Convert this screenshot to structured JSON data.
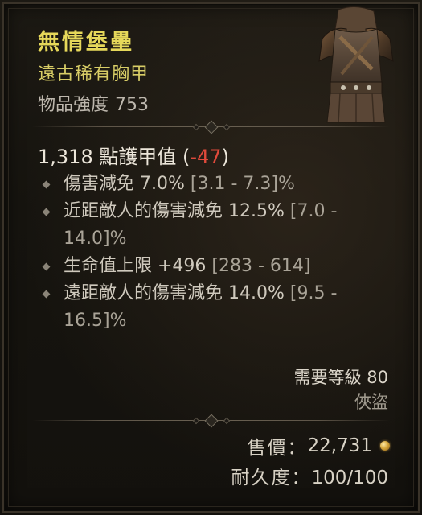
{
  "item": {
    "name": "無情堡壘",
    "type": "遠古稀有胸甲",
    "power_label": "物品強度",
    "power_value": "753",
    "portrait_icon": "chest-armor-icon"
  },
  "armor": {
    "value": "1,318",
    "label": "點護甲值",
    "open_paren": "(",
    "delta": "-47",
    "close_paren": ")"
  },
  "affixes": [
    {
      "text": "傷害減免 7.0%",
      "range": "[3.1 - 7.3]%"
    },
    {
      "text": "近距敵人的傷害減免 12.5%",
      "range": "[7.0 - 14.0]%"
    },
    {
      "text": "生命值上限 +496",
      "range": "[283 - 614]"
    },
    {
      "text": "遠距敵人的傷害減免 14.0%",
      "range": "[9.5 - 16.5]%"
    }
  ],
  "requirements": {
    "level_label": "需要等級",
    "level_value": "80",
    "class": "俠盜"
  },
  "sell": {
    "label": "售價：",
    "value": "22,731",
    "icon": "gold-coin-icon"
  },
  "durability": {
    "label": "耐久度：",
    "value": "100/100"
  },
  "colors": {
    "name": "#e6d85a",
    "type": "#d8cd66",
    "negative_delta": "#e04a3b",
    "background": "#16140f"
  }
}
